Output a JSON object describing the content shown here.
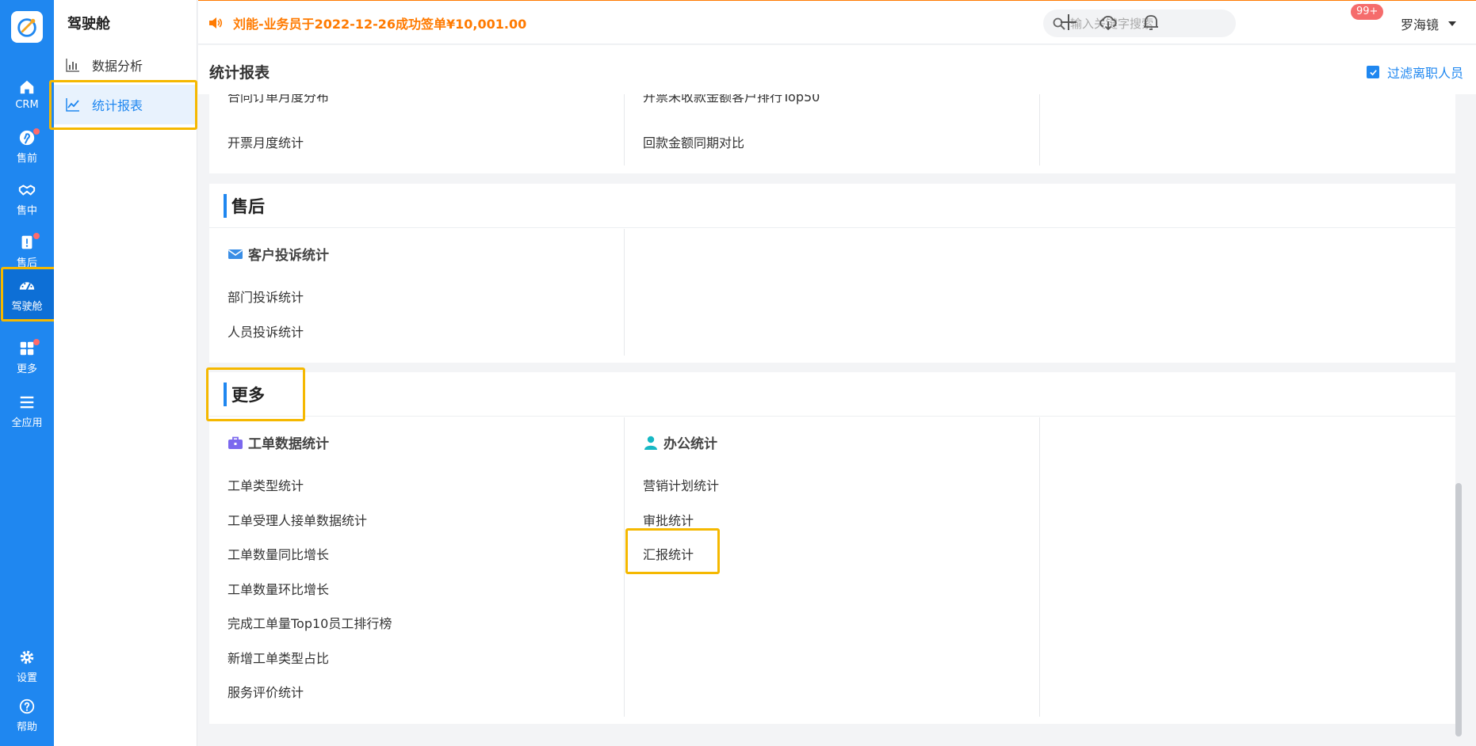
{
  "rail": {
    "items": [
      {
        "label": "CRM",
        "icon": "home-icon"
      },
      {
        "label": "售前",
        "icon": "pin-icon",
        "dot": true
      },
      {
        "label": "售中",
        "icon": "handshake-icon"
      },
      {
        "label": "售后",
        "icon": "badge-icon",
        "dot": true
      },
      {
        "label": "驾驶舱",
        "icon": "dashboard-icon",
        "active": true
      },
      {
        "label": "更多",
        "icon": "grid-icon",
        "dot": true
      },
      {
        "label": "全应用",
        "icon": "menu-icon"
      }
    ],
    "bottom": [
      {
        "label": "设置",
        "icon": "gear-icon"
      },
      {
        "label": "帮助",
        "icon": "help-icon"
      }
    ]
  },
  "sidebar": {
    "title": "驾驶舱",
    "items": [
      {
        "label": "数据分析",
        "icon": "bar-chart-icon"
      },
      {
        "label": "统计报表",
        "icon": "line-chart-icon",
        "active": true
      }
    ]
  },
  "topbar": {
    "notice": "刘能-业务员于2022-12-26成功签单¥10,001.00",
    "search_placeholder": "输入关键字搜索",
    "badge": "99+",
    "user": "罗海镜"
  },
  "page": {
    "title": "统计报表",
    "filter_label": "过滤离职人员"
  },
  "section_top": {
    "cut_left": "合同订单月度分布",
    "cut_mid": "开票未收款金额客户排行Top50",
    "left_link": "开票月度统计",
    "mid_link": "回款金额同期对比"
  },
  "section_after_sales": {
    "title": "售后",
    "group": {
      "title": "客户投诉统计",
      "icon": "envelope-icon",
      "links": [
        "部门投诉统计",
        "人员投诉统计"
      ]
    }
  },
  "section_more": {
    "title": "更多",
    "groups": [
      {
        "title": "工单数据统计",
        "icon": "briefcase-icon",
        "links": [
          "工单类型统计",
          "工单受理人接单数据统计",
          "工单数量同比增长",
          "工单数量环比增长",
          "完成工单量Top10员工排行榜",
          "新增工单类型占比",
          "服务评价统计"
        ]
      },
      {
        "title": "办公统计",
        "icon": "person-icon",
        "links": [
          "营销计划统计",
          "审批统计",
          "汇报统计"
        ]
      }
    ]
  },
  "colors": {
    "primary": "#1f87f0",
    "notice": "#ff7a00",
    "highlight": "#f5b800",
    "badge": "#f56c6c"
  }
}
